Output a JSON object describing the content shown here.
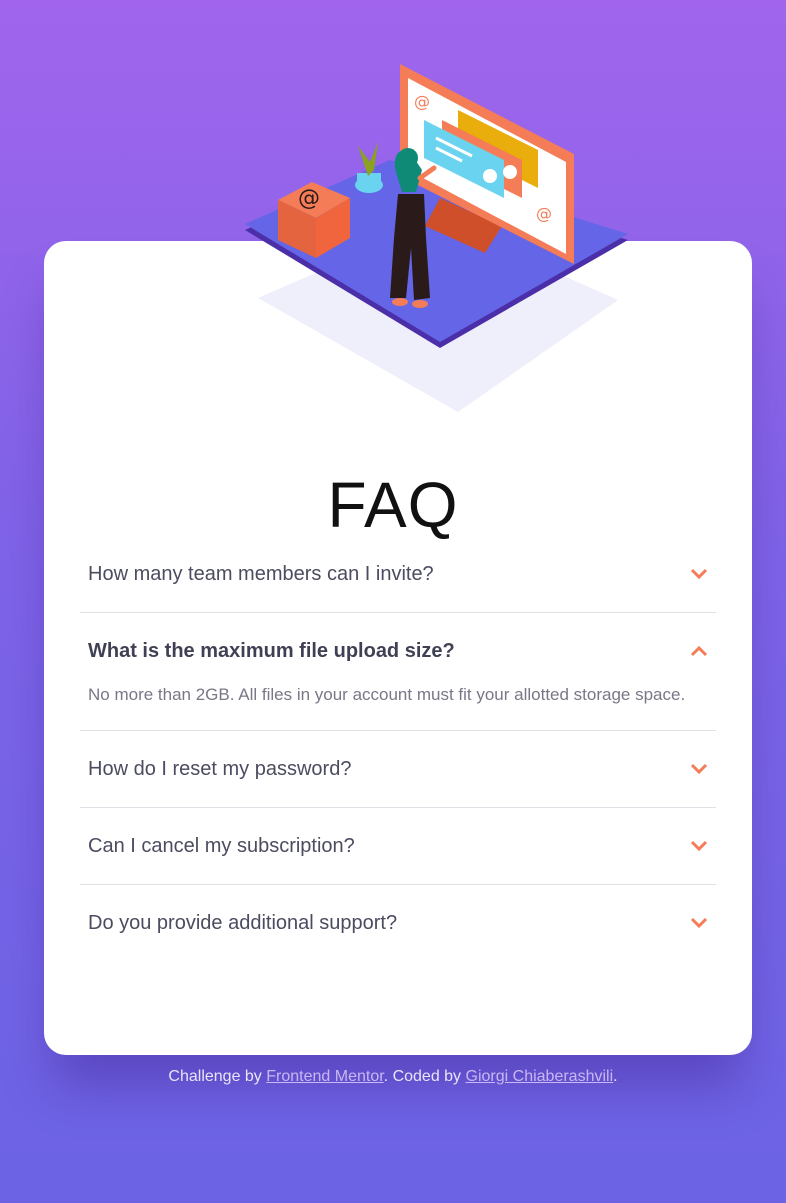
{
  "faq": {
    "title": "FAQ",
    "items": [
      {
        "question": "How many team members can I invite?",
        "open": false,
        "answer": ""
      },
      {
        "question": "What is the maximum file upload size?",
        "open": true,
        "answer": "No more than 2GB. All files in your account must fit your allotted storage space."
      },
      {
        "question": "How do I reset my password?",
        "open": false,
        "answer": ""
      },
      {
        "question": "Can I cancel my subscription?",
        "open": false,
        "answer": ""
      },
      {
        "question": "Do you provide additional support?",
        "open": false,
        "answer": ""
      }
    ]
  },
  "footer": {
    "prefix": "Challenge by",
    "link1": "Frontend Mentor",
    "middle": ". Coded by",
    "link2": "Giorgi Chiaberashvili",
    "suffix": "."
  },
  "colors": {
    "accent": "#f47c57",
    "bg_top": "#a065ec",
    "bg_bottom": "#6b63e4"
  }
}
